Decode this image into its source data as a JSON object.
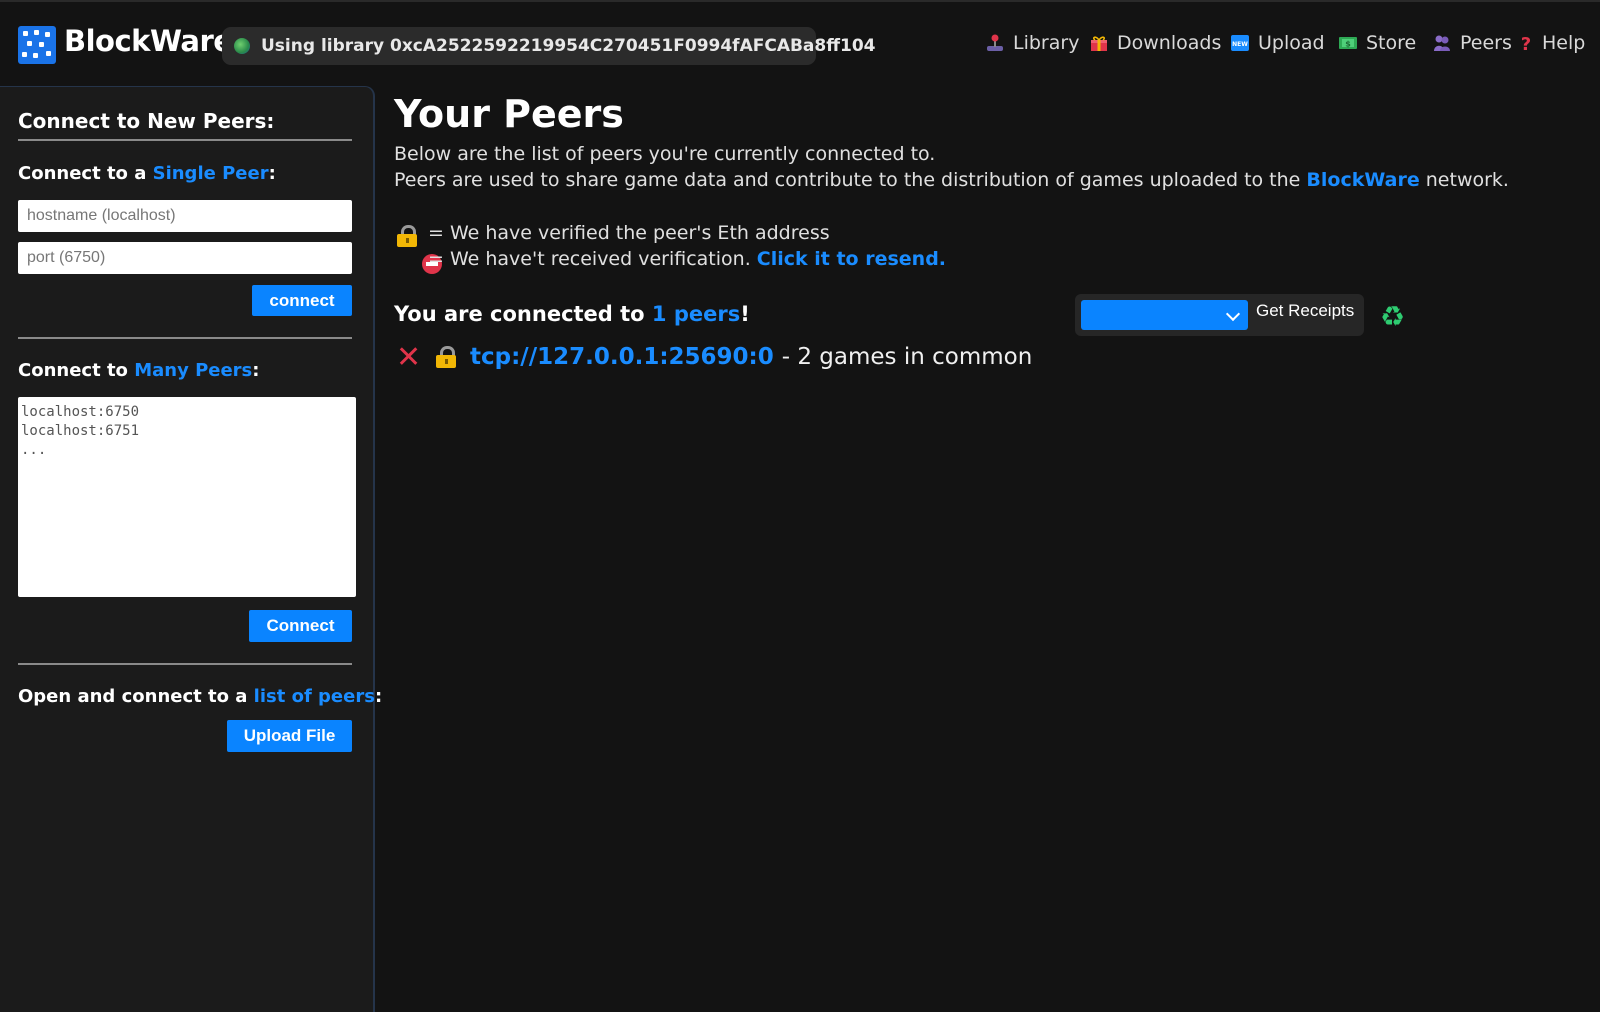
{
  "app": {
    "name": "BlockWare",
    "library_label": "Using library 0xcA2522592219954C270451F0994fAFCABa8ff104"
  },
  "nav": [
    {
      "label": "Library",
      "icon": "joystick-icon"
    },
    {
      "label": "Downloads",
      "icon": "gift-icon"
    },
    {
      "label": "Upload",
      "icon": "new-badge-icon"
    },
    {
      "label": "Store",
      "icon": "money-icon"
    },
    {
      "label": "Peers",
      "icon": "peers-icon"
    },
    {
      "label": "Help",
      "icon": "question-icon"
    }
  ],
  "sidebar": {
    "heading": "Connect to New Peers:",
    "single": {
      "prefix": "Connect to a ",
      "link": "Single Peer",
      "suffix": ":",
      "hostname_placeholder": "hostname (localhost)",
      "port_placeholder": "port (6750)",
      "button": "connect"
    },
    "many": {
      "prefix": "Connect to ",
      "link": "Many Peers",
      "suffix": ":",
      "placeholder": "localhost:6750\nlocalhost:6751\n...",
      "button": "Connect"
    },
    "file": {
      "prefix": "Open and connect to a ",
      "link": "list of peers",
      "suffix": ":",
      "button": "Upload File"
    }
  },
  "main": {
    "title": "Your Peers",
    "desc_line1": "Below are the list of peers you're currently connected to.",
    "desc_line2_prefix": "Peers are used to share game data and contribute to the distribution of games uploaded to the ",
    "desc_line2_link": "BlockWare",
    "desc_line2_suffix": " network.",
    "legend_verified": "= We have verified the peer's Eth address",
    "legend_unverified_prefix": "= We have't received verification. ",
    "legend_unverified_link": "Click it to resend.",
    "connected_prefix": "You are connected to ",
    "connected_link": "1 peers",
    "connected_suffix": "!",
    "receipts_button": "Get Receipts",
    "peers": [
      {
        "address": "tcp://127.0.0.1:25690:0",
        "info": "- 2 games in common",
        "verified": true
      }
    ]
  },
  "colors": {
    "accent": "#0a84ff",
    "link": "#1a8cff",
    "background": "#131313",
    "sidebar": "#1b1b1b"
  }
}
